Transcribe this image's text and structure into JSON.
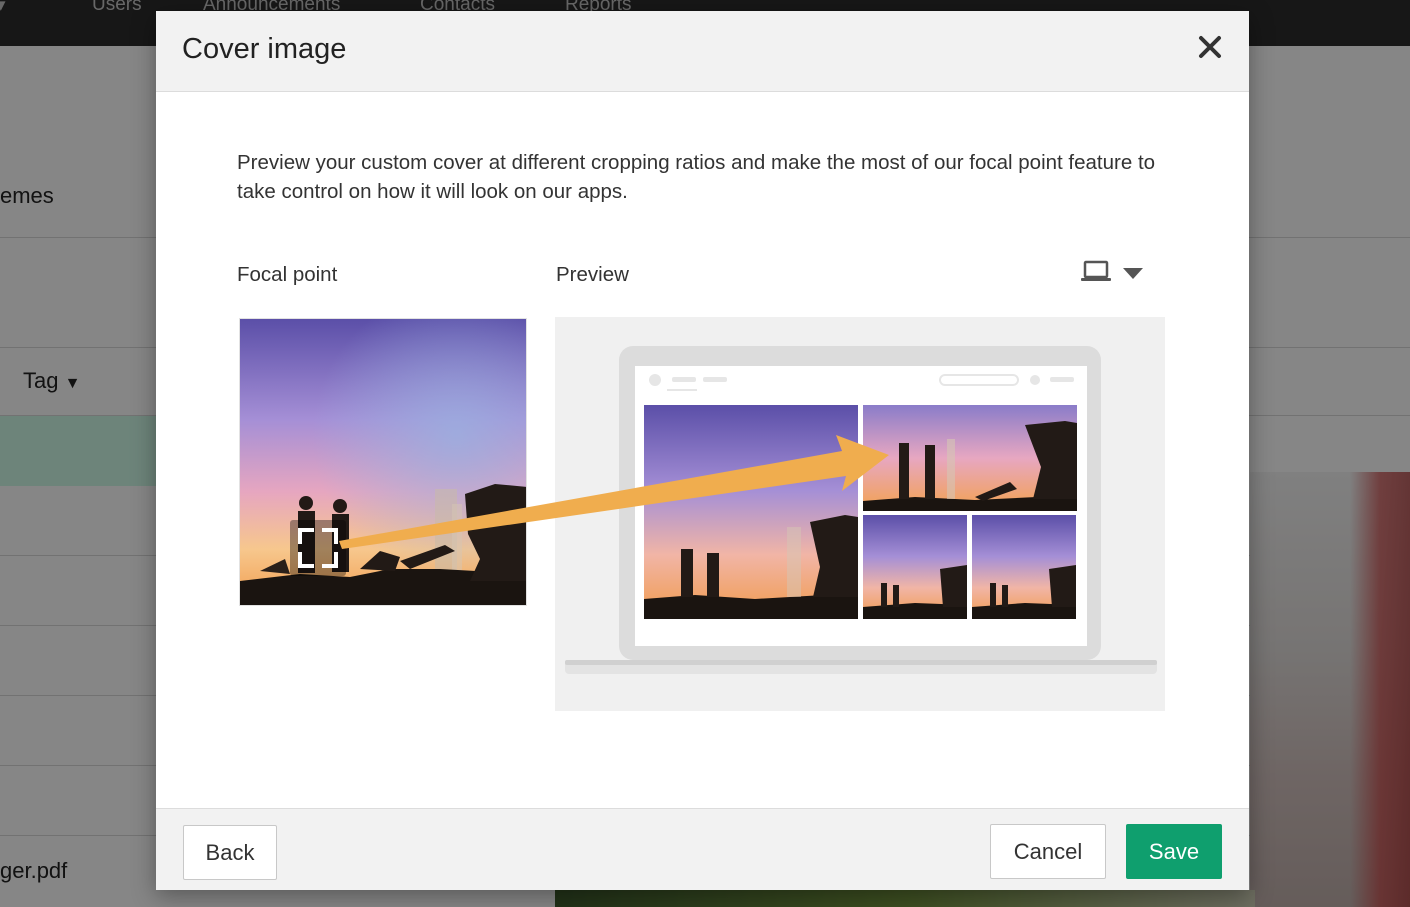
{
  "background": {
    "nav": [
      "Users",
      "Announcements",
      "Contacts",
      "Reports"
    ],
    "side_text_themes": "emes",
    "side_text_tag": "Tag",
    "side_text_file": "ger.pdf"
  },
  "modal": {
    "title": "Cover image",
    "close_icon": "close-icon",
    "description": "Preview your custom cover at different cropping ratios and make the most of our focal point feature to take control on how it will look on our apps.",
    "focal_label": "Focal point",
    "preview_label": "Preview",
    "device_icon": "laptop-icon",
    "footer": {
      "back": "Back",
      "cancel": "Cancel",
      "save": "Save"
    }
  },
  "colors": {
    "save": "#0f9f6e",
    "arrow": "#f0ad4e",
    "header_bg": "#f2f2f2"
  }
}
